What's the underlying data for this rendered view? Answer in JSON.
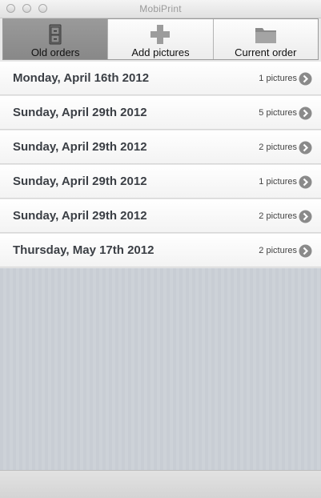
{
  "window": {
    "title": "MobiPrint"
  },
  "toolbar": {
    "items": [
      {
        "label": "Old orders",
        "icon": "cabinet-icon",
        "selected": true
      },
      {
        "label": "Add pictures",
        "icon": "plus-icon",
        "selected": false
      },
      {
        "label": "Current order",
        "icon": "folder-icon",
        "selected": false
      }
    ]
  },
  "orders": [
    {
      "date": "Monday, April 16th 2012",
      "count": "1 pictures"
    },
    {
      "date": "Sunday, April 29th 2012",
      "count": "5 pictures"
    },
    {
      "date": "Sunday, April 29th 2012",
      "count": "2 pictures"
    },
    {
      "date": "Sunday, April 29th 2012",
      "count": "1 pictures"
    },
    {
      "date": "Sunday, April 29th 2012",
      "count": "2 pictures"
    },
    {
      "date": "Thursday, May 17th 2012",
      "count": "2 pictures"
    }
  ],
  "colors": {
    "selected_tab": "#8f8f8f",
    "date_text": "#3b3f45",
    "empty_area": "#c8cdd4"
  }
}
